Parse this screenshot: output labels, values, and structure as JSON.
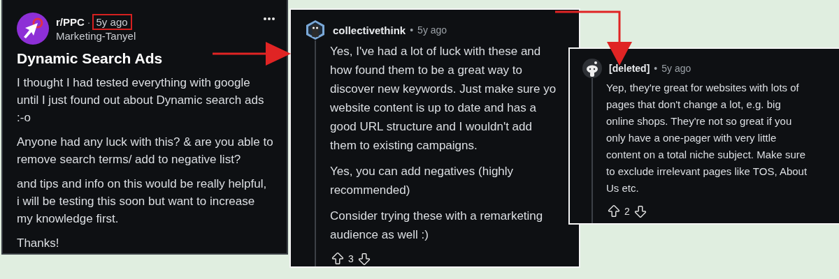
{
  "post": {
    "subreddit": "r/PPC",
    "separator": "·",
    "time": "5y ago",
    "time_highlighted": true,
    "author": "Marketing-Tanyel",
    "title": "Dynamic Search Ads",
    "paragraphs": [
      [
        "I thought I had tested everything with google",
        "until I just found out about Dynamic search ads",
        ":-o"
      ],
      [
        "Anyone had any luck with this? & are you able to",
        "remove search terms/ add to negative list?"
      ],
      [
        "and tips and info on this would be really helpful,",
        "i will be testing this soon but want to increase",
        "my knowledge first."
      ],
      [
        "Thanks!"
      ]
    ]
  },
  "comments": [
    {
      "author": "collectivethink",
      "separator": "•",
      "time": "5y ago",
      "votes": "3",
      "paragraphs": [
        [
          "Yes, I've had a lot of luck with these and",
          "how found them to be a great way to",
          "discover new keywords. Just make sure yo",
          "website content is up to date and has a",
          "good URL structure and I wouldn't add",
          "them to existing campaigns."
        ],
        [
          "Yes, you can add negatives (highly",
          "recommended)"
        ],
        [
          "Consider trying these with a remarketing",
          "audience as well :)"
        ]
      ]
    },
    {
      "author": "[deleted]",
      "separator": "•",
      "time": "5y ago",
      "votes": "2",
      "paragraphs": [
        [
          "Yep, they're great for websites with lots of",
          "pages that don't change a lot, e.g. big",
          "online shops. They're not so great if you",
          "only have a one-pager with very little",
          "content on a total niche subject. Make sure",
          "to exclude irrelevant pages like TOS, About",
          "Us etc."
        ]
      ]
    }
  ]
}
